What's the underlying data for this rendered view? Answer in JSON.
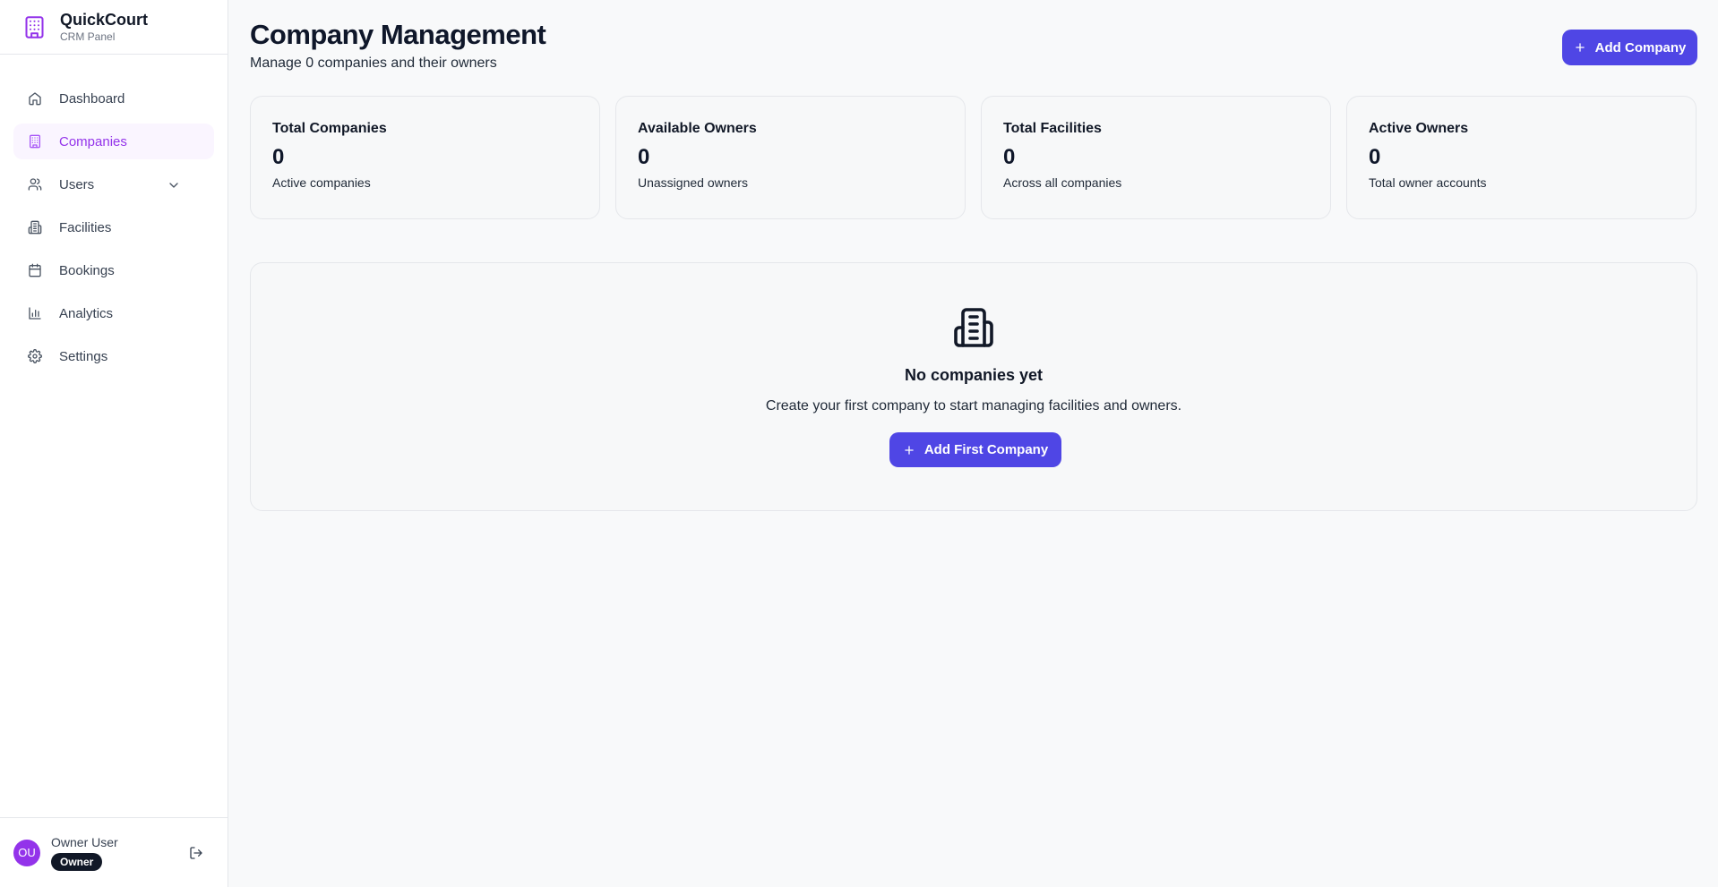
{
  "brand": {
    "title": "QuickCourt",
    "subtitle": "CRM Panel"
  },
  "sidebar": {
    "items": [
      {
        "label": "Dashboard",
        "icon": "home-icon"
      },
      {
        "label": "Companies",
        "icon": "building-icon",
        "active": true
      },
      {
        "label": "Users",
        "icon": "users-icon",
        "expandable": true
      },
      {
        "label": "Facilities",
        "icon": "facility-icon"
      },
      {
        "label": "Bookings",
        "icon": "calendar-icon"
      },
      {
        "label": "Analytics",
        "icon": "bar-chart-icon"
      },
      {
        "label": "Settings",
        "icon": "gear-icon"
      }
    ]
  },
  "user": {
    "initials": "OU",
    "name": "Owner User",
    "role": "Owner"
  },
  "header": {
    "title": "Company Management",
    "subtitle": "Manage 0 companies and their owners",
    "add_button": "Add Company"
  },
  "stats": [
    {
      "title": "Total Companies",
      "value": "0",
      "desc": "Active companies"
    },
    {
      "title": "Available Owners",
      "value": "0",
      "desc": "Unassigned owners"
    },
    {
      "title": "Total Facilities",
      "value": "0",
      "desc": "Across all companies"
    },
    {
      "title": "Active Owners",
      "value": "0",
      "desc": "Total owner accounts"
    }
  ],
  "empty_state": {
    "title": "No companies yet",
    "description": "Create your first company to start managing facilities and owners.",
    "button": "Add First Company"
  },
  "colors": {
    "accent": "#9333ea",
    "primary_button": "#4f46e5",
    "active_nav_bg": "#faf5ff"
  }
}
